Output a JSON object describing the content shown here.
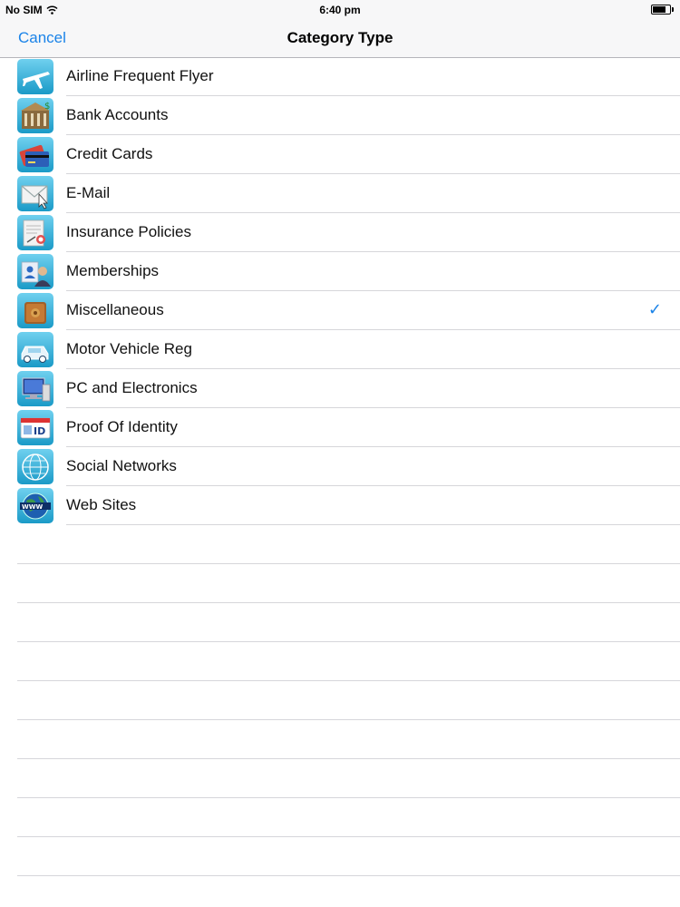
{
  "status": {
    "carrier": "No SIM",
    "time": "6:40 pm",
    "battery_level": 0.75
  },
  "nav": {
    "cancel_label": "Cancel",
    "title": "Category Type"
  },
  "categories": [
    {
      "label": "Airline Frequent Flyer",
      "icon": "airplane-icon",
      "selected": false
    },
    {
      "label": "Bank Accounts",
      "icon": "bank-icon",
      "selected": false
    },
    {
      "label": "Credit Cards",
      "icon": "credit-card-icon",
      "selected": false
    },
    {
      "label": "E-Mail",
      "icon": "email-icon",
      "selected": false
    },
    {
      "label": "Insurance Policies",
      "icon": "insurance-icon",
      "selected": false
    },
    {
      "label": "Memberships",
      "icon": "membership-icon",
      "selected": false
    },
    {
      "label": "Miscellaneous",
      "icon": "miscellaneous-icon",
      "selected": true
    },
    {
      "label": "Motor Vehicle Reg",
      "icon": "vehicle-icon",
      "selected": false
    },
    {
      "label": "PC and Electronics",
      "icon": "computer-icon",
      "selected": false
    },
    {
      "label": "Proof Of Identity",
      "icon": "id-card-icon",
      "selected": false
    },
    {
      "label": "Social Networks",
      "icon": "globe-network-icon",
      "selected": false
    },
    {
      "label": "Web Sites",
      "icon": "www-globe-icon",
      "selected": false
    }
  ],
  "checkmark": "✓",
  "colors": {
    "accent": "#1a83e8",
    "separator": "#d6d6da",
    "icon_bg_top": "#6fd0ef",
    "icon_bg_bottom": "#1a9ac7"
  }
}
